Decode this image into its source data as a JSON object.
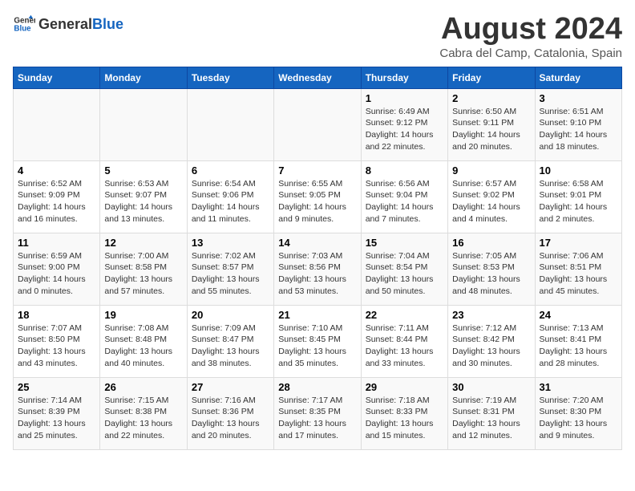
{
  "header": {
    "logo_general": "General",
    "logo_blue": "Blue",
    "title": "August 2024",
    "subtitle": "Cabra del Camp, Catalonia, Spain"
  },
  "days_of_week": [
    "Sunday",
    "Monday",
    "Tuesday",
    "Wednesday",
    "Thursday",
    "Friday",
    "Saturday"
  ],
  "weeks": [
    [
      {
        "day": "",
        "info": ""
      },
      {
        "day": "",
        "info": ""
      },
      {
        "day": "",
        "info": ""
      },
      {
        "day": "",
        "info": ""
      },
      {
        "day": "1",
        "info": "Sunrise: 6:49 AM\nSunset: 9:12 PM\nDaylight: 14 hours\nand 22 minutes."
      },
      {
        "day": "2",
        "info": "Sunrise: 6:50 AM\nSunset: 9:11 PM\nDaylight: 14 hours\nand 20 minutes."
      },
      {
        "day": "3",
        "info": "Sunrise: 6:51 AM\nSunset: 9:10 PM\nDaylight: 14 hours\nand 18 minutes."
      }
    ],
    [
      {
        "day": "4",
        "info": "Sunrise: 6:52 AM\nSunset: 9:09 PM\nDaylight: 14 hours\nand 16 minutes."
      },
      {
        "day": "5",
        "info": "Sunrise: 6:53 AM\nSunset: 9:07 PM\nDaylight: 14 hours\nand 13 minutes."
      },
      {
        "day": "6",
        "info": "Sunrise: 6:54 AM\nSunset: 9:06 PM\nDaylight: 14 hours\nand 11 minutes."
      },
      {
        "day": "7",
        "info": "Sunrise: 6:55 AM\nSunset: 9:05 PM\nDaylight: 14 hours\nand 9 minutes."
      },
      {
        "day": "8",
        "info": "Sunrise: 6:56 AM\nSunset: 9:04 PM\nDaylight: 14 hours\nand 7 minutes."
      },
      {
        "day": "9",
        "info": "Sunrise: 6:57 AM\nSunset: 9:02 PM\nDaylight: 14 hours\nand 4 minutes."
      },
      {
        "day": "10",
        "info": "Sunrise: 6:58 AM\nSunset: 9:01 PM\nDaylight: 14 hours\nand 2 minutes."
      }
    ],
    [
      {
        "day": "11",
        "info": "Sunrise: 6:59 AM\nSunset: 9:00 PM\nDaylight: 14 hours\nand 0 minutes."
      },
      {
        "day": "12",
        "info": "Sunrise: 7:00 AM\nSunset: 8:58 PM\nDaylight: 13 hours\nand 57 minutes."
      },
      {
        "day": "13",
        "info": "Sunrise: 7:02 AM\nSunset: 8:57 PM\nDaylight: 13 hours\nand 55 minutes."
      },
      {
        "day": "14",
        "info": "Sunrise: 7:03 AM\nSunset: 8:56 PM\nDaylight: 13 hours\nand 53 minutes."
      },
      {
        "day": "15",
        "info": "Sunrise: 7:04 AM\nSunset: 8:54 PM\nDaylight: 13 hours\nand 50 minutes."
      },
      {
        "day": "16",
        "info": "Sunrise: 7:05 AM\nSunset: 8:53 PM\nDaylight: 13 hours\nand 48 minutes."
      },
      {
        "day": "17",
        "info": "Sunrise: 7:06 AM\nSunset: 8:51 PM\nDaylight: 13 hours\nand 45 minutes."
      }
    ],
    [
      {
        "day": "18",
        "info": "Sunrise: 7:07 AM\nSunset: 8:50 PM\nDaylight: 13 hours\nand 43 minutes."
      },
      {
        "day": "19",
        "info": "Sunrise: 7:08 AM\nSunset: 8:48 PM\nDaylight: 13 hours\nand 40 minutes."
      },
      {
        "day": "20",
        "info": "Sunrise: 7:09 AM\nSunset: 8:47 PM\nDaylight: 13 hours\nand 38 minutes."
      },
      {
        "day": "21",
        "info": "Sunrise: 7:10 AM\nSunset: 8:45 PM\nDaylight: 13 hours\nand 35 minutes."
      },
      {
        "day": "22",
        "info": "Sunrise: 7:11 AM\nSunset: 8:44 PM\nDaylight: 13 hours\nand 33 minutes."
      },
      {
        "day": "23",
        "info": "Sunrise: 7:12 AM\nSunset: 8:42 PM\nDaylight: 13 hours\nand 30 minutes."
      },
      {
        "day": "24",
        "info": "Sunrise: 7:13 AM\nSunset: 8:41 PM\nDaylight: 13 hours\nand 28 minutes."
      }
    ],
    [
      {
        "day": "25",
        "info": "Sunrise: 7:14 AM\nSunset: 8:39 PM\nDaylight: 13 hours\nand 25 minutes."
      },
      {
        "day": "26",
        "info": "Sunrise: 7:15 AM\nSunset: 8:38 PM\nDaylight: 13 hours\nand 22 minutes."
      },
      {
        "day": "27",
        "info": "Sunrise: 7:16 AM\nSunset: 8:36 PM\nDaylight: 13 hours\nand 20 minutes."
      },
      {
        "day": "28",
        "info": "Sunrise: 7:17 AM\nSunset: 8:35 PM\nDaylight: 13 hours\nand 17 minutes."
      },
      {
        "day": "29",
        "info": "Sunrise: 7:18 AM\nSunset: 8:33 PM\nDaylight: 13 hours\nand 15 minutes."
      },
      {
        "day": "30",
        "info": "Sunrise: 7:19 AM\nSunset: 8:31 PM\nDaylight: 13 hours\nand 12 minutes."
      },
      {
        "day": "31",
        "info": "Sunrise: 7:20 AM\nSunset: 8:30 PM\nDaylight: 13 hours\nand 9 minutes."
      }
    ]
  ]
}
